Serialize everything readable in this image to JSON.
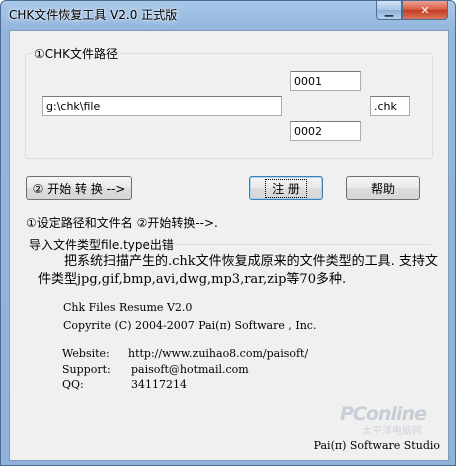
{
  "window": {
    "title": "CHK文件恢复工具 V2.0 正式版",
    "minimize_glyph": "▁",
    "close_glyph": "✕"
  },
  "path_group": {
    "legend": "①CHK文件路径",
    "path_value": "g:\\chk\\file",
    "start_number": "0001",
    "end_number": "0002",
    "extension": ".chk"
  },
  "buttons": {
    "start_label": "② 开始 转 换 -->",
    "register_label": "注 册",
    "help_label": "帮助"
  },
  "hint": "①设定路径和文件名 ②开始转换-->.",
  "info": {
    "legend": "导入文件类型file.type出错",
    "description": "把系统扫描产生的.chk文件恢复成原来的文件类型的工具. 支持文件类型jpg,gif,bmp,avi,dwg,mp3,rar,zip等70多种.",
    "product": "Chk Files Resume V2.0",
    "copyright": "Copyrite (C) 2004-2007  Pai(π)  Software ,  Inc.",
    "website_label": "Website:",
    "website_value": "http://www.zuihao8.com/paisoft/",
    "support_label": "Support:",
    "support_value": "paisoft@hotmail.com",
    "qq_label": "QQ:",
    "qq_value": "34117214",
    "brand": "Pai(π) Software Studio"
  },
  "watermark": {
    "text": "PConline",
    "sub": "太平洋电脑网"
  }
}
